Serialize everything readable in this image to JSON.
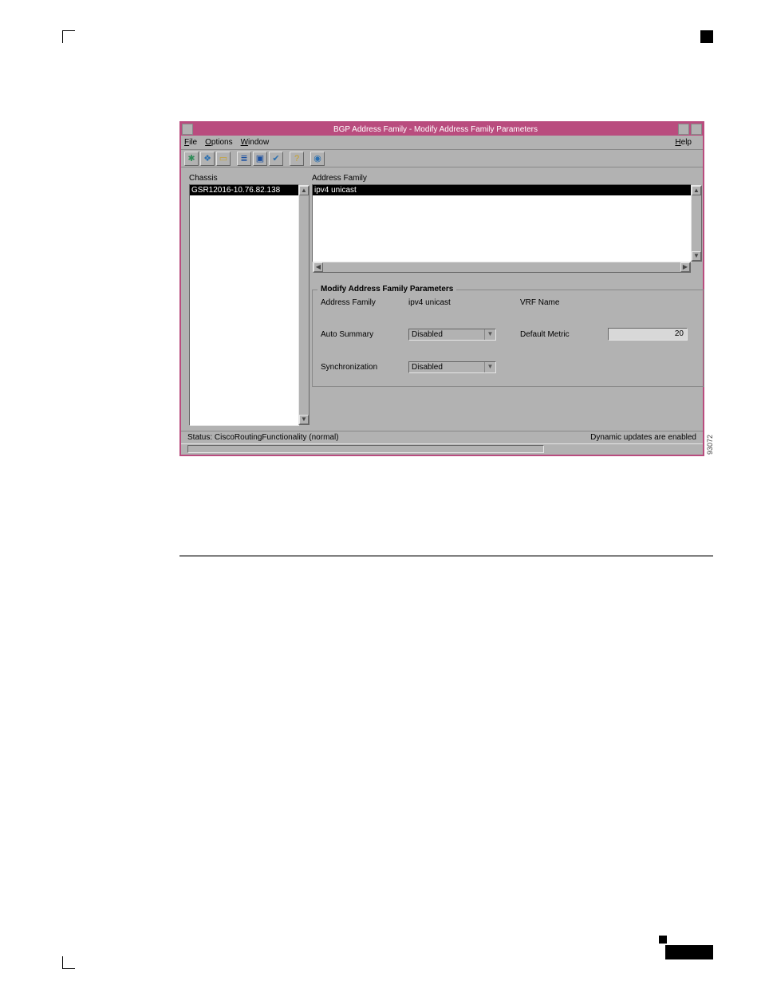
{
  "window": {
    "title": "BGP Address Family - Modify Address Family Parameters"
  },
  "menubar": {
    "file": "File",
    "options": "Options",
    "window": "Window",
    "help": "Help"
  },
  "toolbar": {
    "icons": [
      "run",
      "stack",
      "open",
      "list",
      "screen",
      "check",
      "question",
      "info"
    ]
  },
  "chassis": {
    "label": "Chassis",
    "items": [
      "GSR12016-10.76.82.138"
    ]
  },
  "address_family": {
    "label": "Address Family",
    "items": [
      "ipv4 unicast"
    ]
  },
  "fieldset": {
    "legend": "Modify Address Family Parameters",
    "af_label": "Address Family",
    "af_value": "ipv4 unicast",
    "vrf_label": "VRF Name",
    "vrf_value": "",
    "auto_summary_label": "Auto Summary",
    "auto_summary_value": "Disabled",
    "default_metric_label": "Default Metric",
    "default_metric_value": "20",
    "sync_label": "Synchronization",
    "sync_value": "Disabled"
  },
  "status": {
    "left": "Status: CiscoRoutingFunctionality (normal)",
    "right": "Dynamic updates are enabled"
  },
  "side_number": "93072"
}
